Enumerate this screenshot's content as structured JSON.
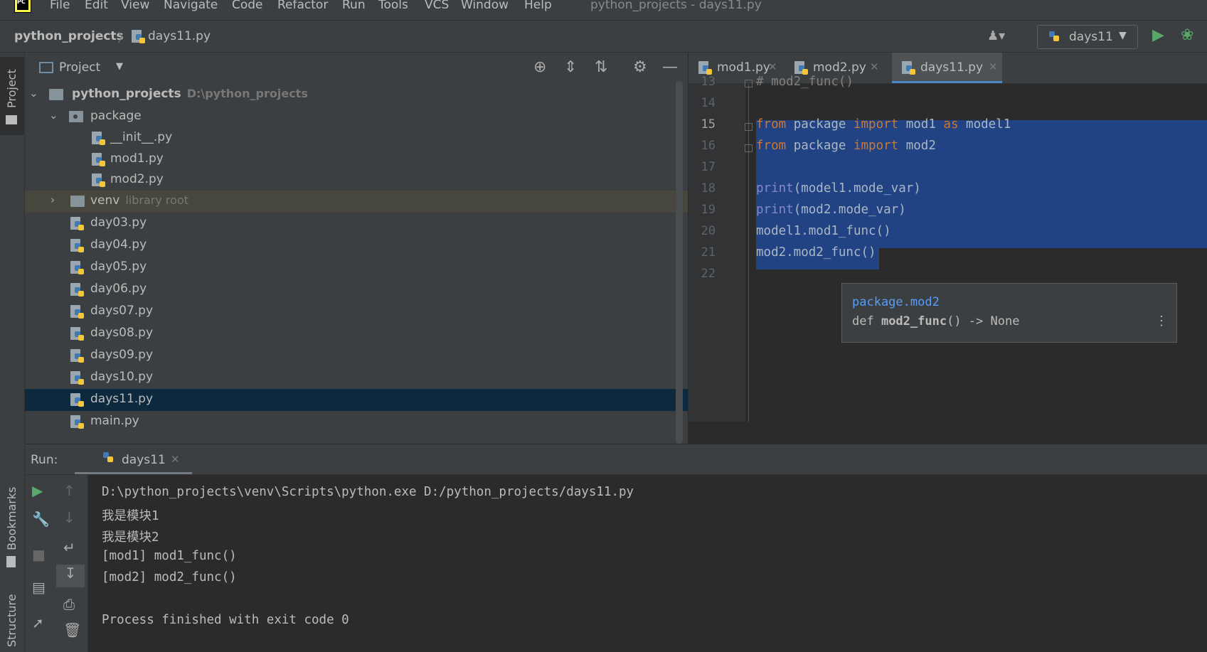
{
  "menubar": {
    "items": [
      "File",
      "Edit",
      "View",
      "Navigate",
      "Code",
      "Refactor",
      "Run",
      "Tools",
      "VCS",
      "Window",
      "Help"
    ],
    "window_title": "python_projects - days11.py",
    "logo": "PC"
  },
  "navbar": {
    "project": "python_projects",
    "separator": "〉",
    "file": "days11.py",
    "run_config": "days11",
    "icons": {
      "user": "user-icon",
      "run": "run-icon",
      "debug": "debug-icon"
    }
  },
  "left_stripe": {
    "project": "Project",
    "bookmarks": "Bookmarks",
    "structure": "Structure"
  },
  "project_panel": {
    "title": "Project",
    "tree": [
      {
        "label": "python_projects",
        "hint": "D:\\python_projects"
      },
      {
        "label": "package"
      },
      {
        "label": "__init__.py"
      },
      {
        "label": "mod1.py"
      },
      {
        "label": "mod2.py"
      },
      {
        "label": "venv",
        "hint": "library root"
      },
      {
        "label": "day03.py"
      },
      {
        "label": "day04.py"
      },
      {
        "label": "day05.py"
      },
      {
        "label": "day06.py"
      },
      {
        "label": "days07.py"
      },
      {
        "label": "days08.py"
      },
      {
        "label": "days09.py"
      },
      {
        "label": "days10.py"
      },
      {
        "label": "days11.py"
      },
      {
        "label": "main.py"
      }
    ]
  },
  "editor": {
    "tabs": [
      "mod1.py",
      "mod2.py",
      "days11.py"
    ],
    "active_tab": "days11.py",
    "line_numbers": [
      "13",
      "14",
      "15",
      "16",
      "17",
      "18",
      "19",
      "20",
      "21",
      "22"
    ],
    "lines": {
      "l13": "# mod2_func()",
      "l15": {
        "kw1": "from",
        "mid1": " package ",
        "kw2": "import",
        "mid2": " mod1 ",
        "kw3": "as",
        "end": " model1"
      },
      "l16": {
        "kw1": "from",
        "mid1": " package ",
        "kw2": "import",
        "end": " mod2"
      },
      "l18": {
        "fn": "print",
        "rest": "(model1.mode_var)"
      },
      "l19": {
        "fn": "print",
        "rest": "(mod2.mode_var)"
      },
      "l20": "model1.mod1_func()",
      "l21": "mod2.mod2_func()"
    },
    "doc_popup": {
      "module": "package.mod2",
      "sig_def": "def ",
      "sig_name": "mod2_func",
      "sig_rest": "() -> None"
    }
  },
  "run_panel": {
    "label": "Run:",
    "tab": "days11",
    "output": [
      "D:\\python_projects\\venv\\Scripts\\python.exe D:/python_projects/days11.py",
      "我是模块1",
      "我是模块2",
      "[mod1] mod1_func()",
      "[mod2] mod2_func()",
      "",
      "Process finished with exit code 0"
    ]
  },
  "colors": {
    "editor_bg": "#2b2b2b",
    "panel_bg": "#3c3f41",
    "selection": "#214283",
    "keyword": "#cc7832",
    "builtin": "#8888c6",
    "accent": "#4a88c7",
    "run_green": "#59a869"
  }
}
